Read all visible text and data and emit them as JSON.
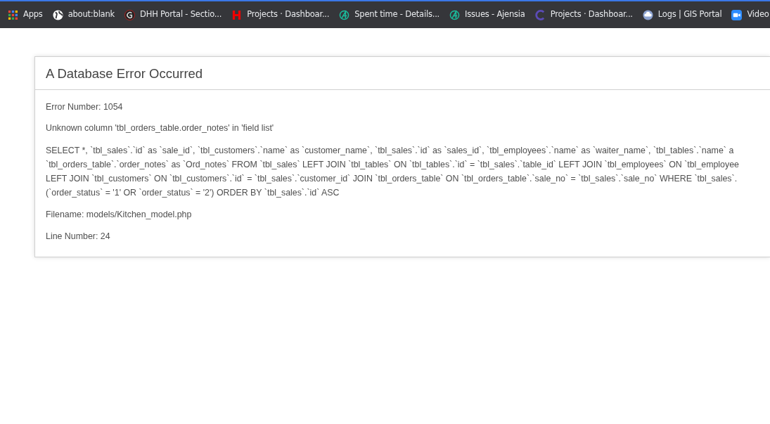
{
  "bookmarks": [
    {
      "label": "Apps"
    },
    {
      "label": "about:blank"
    },
    {
      "label": "DHH Portal - Sectio..."
    },
    {
      "label": "Projects · Dashboar..."
    },
    {
      "label": "Spent time - Details..."
    },
    {
      "label": "Issues - Ajensia"
    },
    {
      "label": "Projects · Dashboar..."
    },
    {
      "label": "Logs | GIS Portal"
    },
    {
      "label": "Video"
    }
  ],
  "error": {
    "title": "A Database Error Occurred",
    "number": "Error Number: 1054",
    "message": "Unknown column 'tbl_orders_table.order_notes' in 'field list'",
    "query_lines": [
      "SELECT *, `tbl_sales`.`id` as `sale_id`, `tbl_customers`.`name` as `customer_name`, `tbl_sales`.`id` as `sales_id`, `tbl_employees`.`name` as `waiter_name`, `tbl_tables`.`name` a",
      "`tbl_orders_table`.`order_notes` as `Ord_notes` FROM `tbl_sales` LEFT JOIN `tbl_tables` ON `tbl_tables`.`id` = `tbl_sales`.`table_id` LEFT JOIN `tbl_employees` ON `tbl_employee",
      "LEFT JOIN `tbl_customers` ON `tbl_customers`.`id` = `tbl_sales`.`customer_id` JOIN `tbl_orders_table` ON `tbl_orders_table`.`sale_no` = `tbl_sales`.`sale_no` WHERE `tbl_sales`.",
      "(`order_status` = '1' OR `order_status` = '2') ORDER BY `tbl_sales`.`id` ASC"
    ],
    "filename": "Filename: models/Kitchen_model.php",
    "line": "Line Number: 24"
  }
}
